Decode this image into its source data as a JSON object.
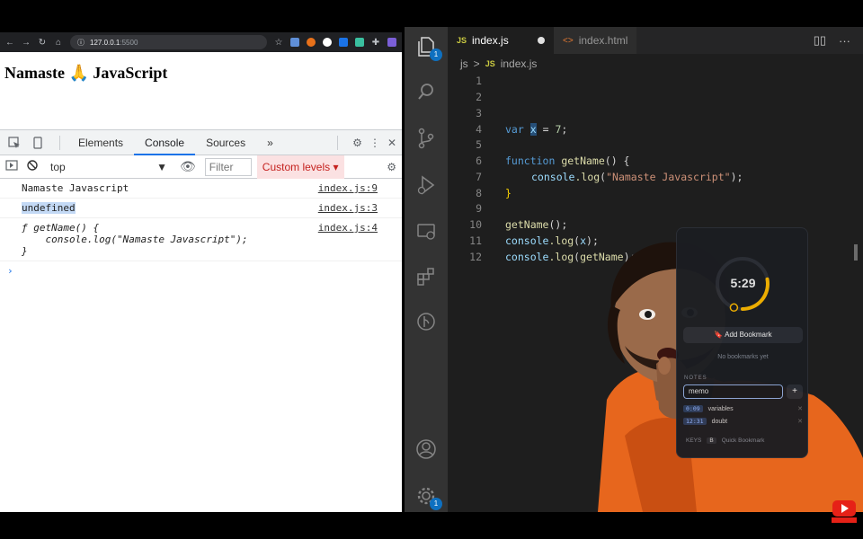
{
  "browser": {
    "url_host": "127.0.0.1",
    "url_port": ":5500",
    "page_heading": "Namaste 🙏 JavaScript"
  },
  "devtools": {
    "tabs": [
      "Elements",
      "Console",
      "Sources"
    ],
    "active_tab": "Console",
    "more_tabs": "»",
    "context": "top",
    "filter_placeholder": "Filter",
    "levels": "Custom levels ▾",
    "console": [
      {
        "text": "Namaste Javascript",
        "source": "index.js:9"
      },
      {
        "text": "undefined",
        "source": "index.js:3"
      },
      {
        "text": "ƒ getName() {\n    console.log(\"Namaste Javascript\");\n}",
        "source": "index.js:4"
      }
    ],
    "prompt": "›"
  },
  "vscode": {
    "tabs": [
      {
        "icon": "JS",
        "label": "index.js",
        "modified": true
      },
      {
        "icon": "<>",
        "label": "index.html"
      }
    ],
    "breadcrumb": {
      "folder": "js",
      "sep": ">",
      "icon": "JS",
      "file": "index.js"
    },
    "explorer_badge": "1",
    "settings_badge": "1",
    "line_numbers": [
      "1",
      "2",
      "3",
      "4",
      "5",
      "6",
      "7",
      "8",
      "9",
      "10",
      "11",
      "12"
    ],
    "code": {
      "l3_kw": "var",
      "l3_var": "x",
      "l3_rest": " = ",
      "l3_num": "7",
      "l3_end": ";",
      "l5_kw": "function",
      "l5_fn": " getName",
      "l5_rest": "() {",
      "l6_obj": "console",
      "l6_fn": ".log",
      "l6_open": "(",
      "l6_str": "\"Namaste Javascript\"",
      "l6_close": ");",
      "l7": "}",
      "l9_fn": "getName",
      "l9_rest": "();",
      "l10_obj": "console",
      "l10_fn": ".log",
      "l10_open": "(",
      "l10_var": "x",
      "l10_close": ");",
      "l11_obj": "console",
      "l11_fn": ".log",
      "l11_open": "(",
      "l11_var": "getName",
      "l11_close": ");"
    }
  },
  "widget": {
    "time": "5:29",
    "timer_progress": 0.28,
    "bookmark_label": "Add Bookmark",
    "empty_text": "No bookmarks yet",
    "notes_header": "NOTES",
    "note_input_value": "memo",
    "add_label": "+",
    "notes": [
      {
        "stamp": "0:09",
        "text": "variables"
      },
      {
        "stamp": "12:31",
        "text": "doubt"
      }
    ],
    "keys_label": "KEYS",
    "key": "B",
    "key_action": "Quick Bookmark"
  },
  "colors": {
    "devtools_accent": "#1a73e8",
    "vscode_bg": "#1e1e1e",
    "activity_bg": "#333333",
    "timer_arc": "#f5b300",
    "youtube_red": "#e62117"
  }
}
